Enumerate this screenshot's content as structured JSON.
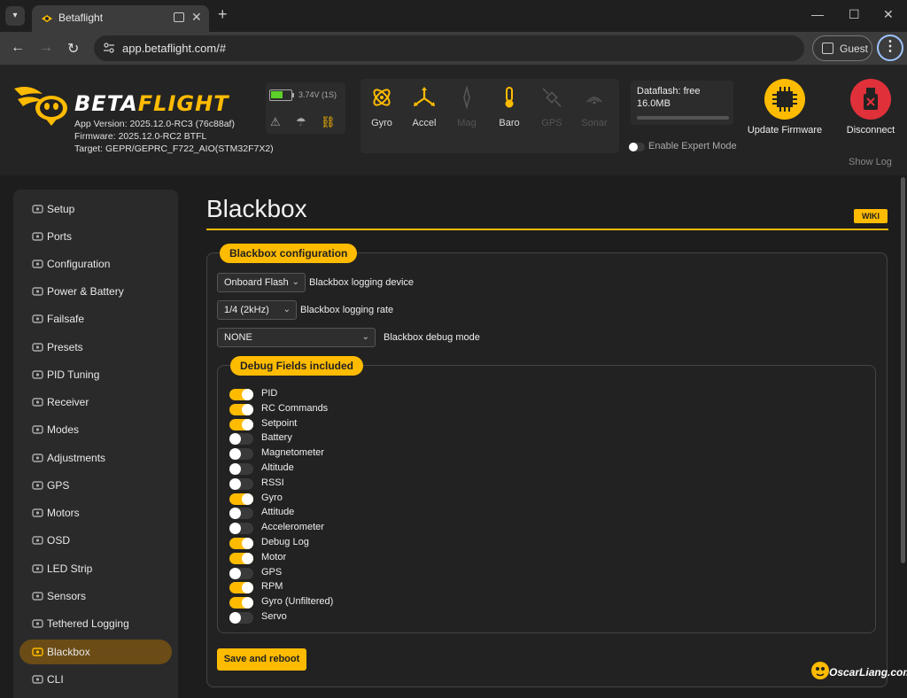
{
  "browser": {
    "tab_title": "Betaflight",
    "url": "app.betaflight.com/#",
    "guest_label": "Guest"
  },
  "header": {
    "logo": {
      "beta": "BETA",
      "flight": "FLIGHT"
    },
    "app_version": "App Version: 2025.12.0-RC3 (76c88af)",
    "firmware": "Firmware: 2025.12.0-RC2 BTFL",
    "target": "Target: GEPR/GEPRC_F722_AIO(STM32F7X2)",
    "battery_text": "3.74V (1S)",
    "battery_level": 0.6,
    "sensors": [
      {
        "label": "Gyro",
        "icon": "gyro-icon",
        "active": true
      },
      {
        "label": "Accel",
        "icon": "accel-icon",
        "active": true
      },
      {
        "label": "Mag",
        "icon": "mag-icon",
        "active": false
      },
      {
        "label": "Baro",
        "icon": "baro-icon",
        "active": true
      },
      {
        "label": "GPS",
        "icon": "gps-icon",
        "active": false
      },
      {
        "label": "Sonar",
        "icon": "sonar-icon",
        "active": false
      }
    ],
    "dataflash_line1": "Dataflash: free",
    "dataflash_line2": "16.0MB",
    "expert_mode_label": "Enable Expert Mode",
    "update_firmware_label": "Update Firmware",
    "disconnect_label": "Disconnect",
    "show_log_label": "Show Log"
  },
  "sidebar": {
    "items": [
      {
        "label": "Setup",
        "icon": "wrench-icon"
      },
      {
        "label": "Ports",
        "icon": "plug-icon"
      },
      {
        "label": "Configuration",
        "icon": "gear-icon"
      },
      {
        "label": "Power & Battery",
        "icon": "battery-icon"
      },
      {
        "label": "Failsafe",
        "icon": "parachute-icon"
      },
      {
        "label": "Presets",
        "icon": "presets-icon"
      },
      {
        "label": "PID Tuning",
        "icon": "pid-icon"
      },
      {
        "label": "Receiver",
        "icon": "receiver-icon"
      },
      {
        "label": "Modes",
        "icon": "modes-icon"
      },
      {
        "label": "Adjustments",
        "icon": "sliders-icon"
      },
      {
        "label": "GPS",
        "icon": "satellite-icon"
      },
      {
        "label": "Motors",
        "icon": "motor-icon"
      },
      {
        "label": "OSD",
        "icon": "osd-icon"
      },
      {
        "label": "LED Strip",
        "icon": "led-icon"
      },
      {
        "label": "Sensors",
        "icon": "sensors-icon"
      },
      {
        "label": "Tethered Logging",
        "icon": "tethered-icon"
      },
      {
        "label": "Blackbox",
        "icon": "blackbox-icon",
        "active": true
      },
      {
        "label": "CLI",
        "icon": "cli-icon"
      }
    ]
  },
  "main": {
    "title": "Blackbox",
    "wiki_label": "WIKI",
    "config_section": "Blackbox configuration",
    "logging_device": {
      "value": "Onboard Flash",
      "label": "Blackbox logging device"
    },
    "logging_rate": {
      "value": "1/4 (2kHz)",
      "label": "Blackbox logging rate"
    },
    "debug_mode": {
      "value": "NONE",
      "label": "Blackbox debug mode"
    },
    "debug_section": "Debug Fields included",
    "debug_fields": [
      {
        "label": "PID",
        "enabled": true
      },
      {
        "label": "RC Commands",
        "enabled": true
      },
      {
        "label": "Setpoint",
        "enabled": true
      },
      {
        "label": "Battery",
        "enabled": false
      },
      {
        "label": "Magnetometer",
        "enabled": false
      },
      {
        "label": "Altitude",
        "enabled": false
      },
      {
        "label": "RSSI",
        "enabled": false
      },
      {
        "label": "Gyro",
        "enabled": true
      },
      {
        "label": "Attitude",
        "enabled": false
      },
      {
        "label": "Accelerometer",
        "enabled": false
      },
      {
        "label": "Debug Log",
        "enabled": true
      },
      {
        "label": "Motor",
        "enabled": true
      },
      {
        "label": "GPS",
        "enabled": false
      },
      {
        "label": "RPM",
        "enabled": true
      },
      {
        "label": "Gyro (Unfiltered)",
        "enabled": true
      },
      {
        "label": "Servo",
        "enabled": false
      }
    ],
    "save_label": "Save and reboot"
  },
  "watermark": "OscarLiang.com",
  "colors": {
    "accent": "#ffbb00",
    "disconnect": "#e0303a",
    "battery": "#5cd12a",
    "active_nav": "#6b4c16"
  }
}
